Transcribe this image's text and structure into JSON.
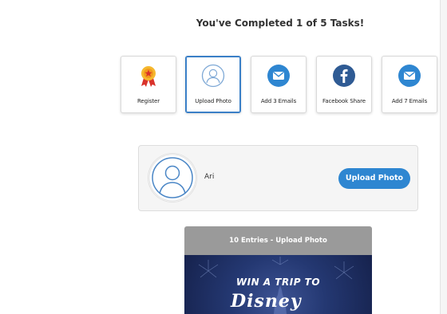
{
  "header": {
    "title": "You've Completed 1 of 5 Tasks!"
  },
  "tasks": [
    {
      "label": "Register",
      "icon": "award-ribbon-icon"
    },
    {
      "label": "Upload Photo",
      "icon": "user-avatar-icon",
      "active": true
    },
    {
      "label": "Add 3 Emails",
      "icon": "envelope-icon"
    },
    {
      "label": "Facebook Share",
      "icon": "facebook-icon"
    },
    {
      "label": "Add 7 Emails",
      "icon": "envelope-icon"
    }
  ],
  "profile": {
    "name": "Ari",
    "button_label": "Upload Photo"
  },
  "promo": {
    "header": "10 Entries - Upload Photo",
    "headline": "WIN A TRIP TO",
    "brand": "Disney"
  },
  "colors": {
    "accent": "#2e86d1",
    "active_border": "#3a7fc7",
    "promo_header_bg": "#9a9a9a",
    "facebook": "#2f5b94"
  }
}
